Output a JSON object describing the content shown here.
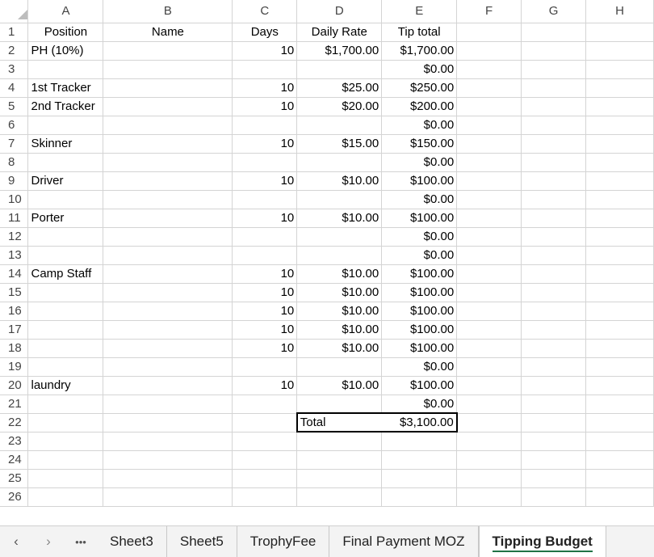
{
  "columns": [
    "A",
    "B",
    "C",
    "D",
    "E",
    "F",
    "G",
    "H"
  ],
  "header_row": {
    "position": "Position",
    "name": "Name",
    "days": "Days",
    "daily_rate": "Daily Rate",
    "tip_total": "Tip total"
  },
  "rows": [
    {
      "num": "2",
      "position": "PH (10%)",
      "days": "10",
      "rate": "$1,700.00",
      "total": "$1,700.00"
    },
    {
      "num": "3",
      "position": "",
      "days": "",
      "rate": "",
      "total": "$0.00"
    },
    {
      "num": "4",
      "position": "1st Tracker",
      "days": "10",
      "rate": "$25.00",
      "total": "$250.00"
    },
    {
      "num": "5",
      "position": "2nd Tracker",
      "days": "10",
      "rate": "$20.00",
      "total": "$200.00"
    },
    {
      "num": "6",
      "position": "",
      "days": "",
      "rate": "",
      "total": "$0.00"
    },
    {
      "num": "7",
      "position": "Skinner",
      "days": "10",
      "rate": "$15.00",
      "total": "$150.00"
    },
    {
      "num": "8",
      "position": "",
      "days": "",
      "rate": "",
      "total": "$0.00"
    },
    {
      "num": "9",
      "position": "Driver",
      "days": "10",
      "rate": "$10.00",
      "total": "$100.00"
    },
    {
      "num": "10",
      "position": "",
      "days": "",
      "rate": "",
      "total": "$0.00"
    },
    {
      "num": "11",
      "position": "Porter",
      "days": "10",
      "rate": "$10.00",
      "total": "$100.00"
    },
    {
      "num": "12",
      "position": "",
      "days": "",
      "rate": "",
      "total": "$0.00"
    },
    {
      "num": "13",
      "position": "",
      "days": "",
      "rate": "",
      "total": "$0.00"
    },
    {
      "num": "14",
      "position": "Camp Staff",
      "days": "10",
      "rate": "$10.00",
      "total": "$100.00"
    },
    {
      "num": "15",
      "position": "",
      "days": "10",
      "rate": "$10.00",
      "total": "$100.00"
    },
    {
      "num": "16",
      "position": "",
      "days": "10",
      "rate": "$10.00",
      "total": "$100.00"
    },
    {
      "num": "17",
      "position": "",
      "days": "10",
      "rate": "$10.00",
      "total": "$100.00"
    },
    {
      "num": "18",
      "position": "",
      "days": "10",
      "rate": "$10.00",
      "total": "$100.00"
    },
    {
      "num": "19",
      "position": "",
      "days": "",
      "rate": "",
      "total": "$0.00"
    },
    {
      "num": "20",
      "position": "laundry",
      "days": "10",
      "rate": "$10.00",
      "total": "$100.00"
    },
    {
      "num": "21",
      "position": "",
      "days": "",
      "rate": "",
      "total": "$0.00"
    }
  ],
  "total_row": {
    "num": "22",
    "label": "Total",
    "value": "$3,100.00"
  },
  "empty_rows": [
    "23",
    "24",
    "25",
    "26"
  ],
  "tabs": {
    "nav_prev": "‹",
    "nav_next": "›",
    "more": "•••",
    "sheets": [
      "Sheet3",
      "Sheet5",
      "TrophyFee",
      "Final Payment MOZ"
    ],
    "active": "Tipping Budget"
  },
  "colors": {
    "accent": "#217346",
    "grid": "#d4d4d4"
  }
}
